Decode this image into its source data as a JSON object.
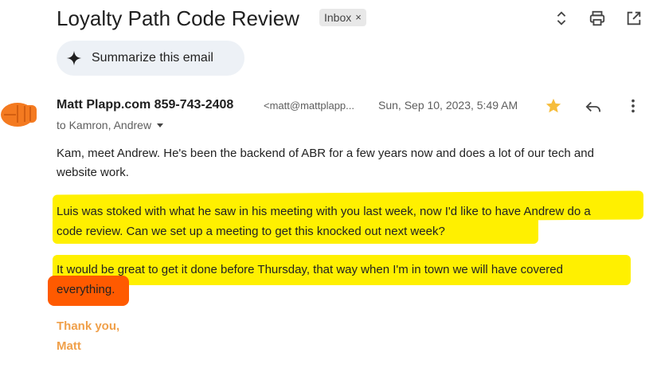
{
  "header": {
    "subject": "Loyalty Path Code Review",
    "label_chip": "Inbox",
    "label_remove": "×",
    "icons": [
      "expand-collapse-icon",
      "print-icon",
      "open-in-new-window-icon"
    ]
  },
  "summarize": {
    "label": "Summarize this email",
    "icon": "sparkle-icon"
  },
  "message": {
    "sender_name": "Matt Plapp.com 859-743-2408",
    "sender_email": "<matt@mattplapp...",
    "date": "Sun, Sep 10, 2023, 5:49 AM",
    "to": "to Kamron, Andrew",
    "starred": true,
    "star_color": "#f6bd3c",
    "paragraphs": [
      "Kam, meet Andrew.  He's been the backend of ABR for a few years now and does a lot of our tech and",
      "website work.",
      "Luis was stoked with what he saw in his meeting with you last week, now I'd like to have Andrew do a",
      "code review.  Can we set up a meeting to get this knocked out next week?",
      "It would be great to get it done before Thursday, that way when I'm in town we will have covered",
      "everything."
    ],
    "signature": [
      "Thank you,",
      "Matt"
    ],
    "highlight_color": "#fff000",
    "accent_highlight_color": "#ff5a00",
    "signature_color": "#f0a04a"
  }
}
